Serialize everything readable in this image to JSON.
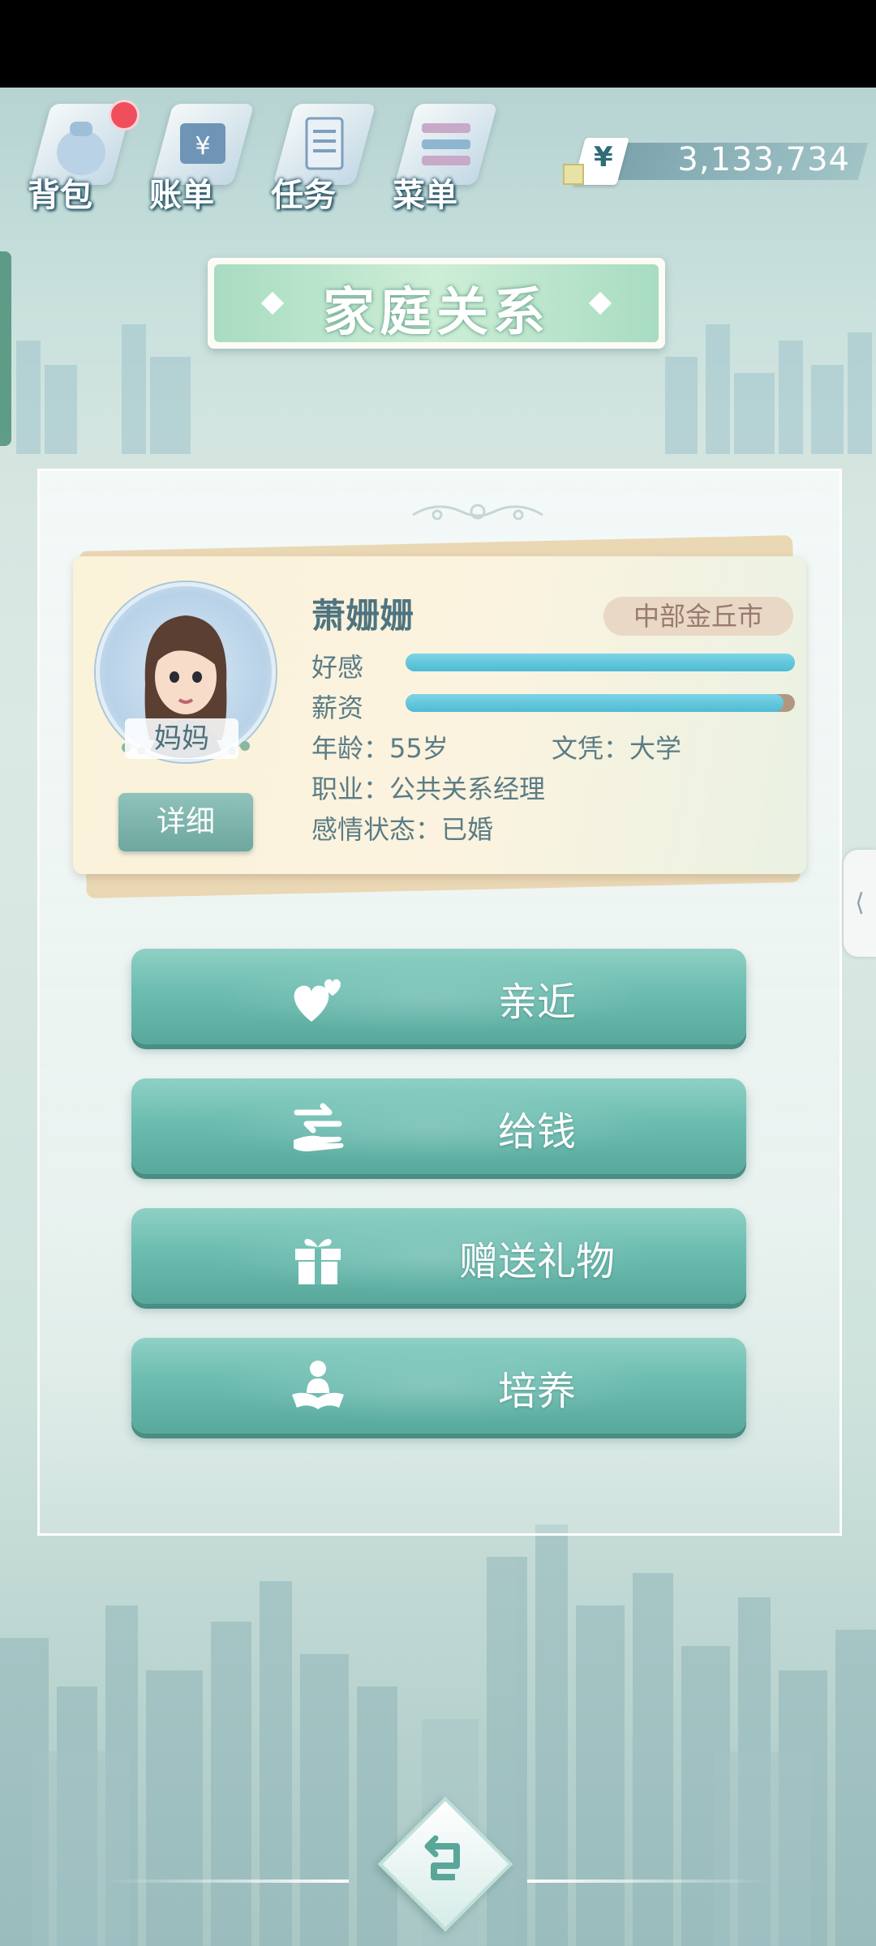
{
  "topbar": {
    "items": [
      {
        "label": "背包",
        "icon": "bag-icon",
        "badge": true
      },
      {
        "label": "账单",
        "icon": "bill-icon"
      },
      {
        "label": "任务",
        "icon": "task-icon"
      },
      {
        "label": "菜单",
        "icon": "menu-icon"
      }
    ],
    "currency_symbol": "¥",
    "money": "3,133,734"
  },
  "page_title": "家庭关系",
  "profile": {
    "name": "萧姗姗",
    "role": "妈妈",
    "region": "中部金丘市",
    "favor_label": "好感",
    "favor_level": 1.0,
    "salary_label": "薪资",
    "salary_level": 0.97,
    "age_text": "年龄：55岁",
    "education_text": "文凭：大学",
    "job_text": "职业：公共关系经理",
    "relationship_text": "感情状态：已婚",
    "detail_button": "详细"
  },
  "actions": [
    {
      "label": "亲近",
      "icon": "hearts-icon"
    },
    {
      "label": "给钱",
      "icon": "give-money-icon"
    },
    {
      "label": "赠送礼物",
      "icon": "gift-icon"
    },
    {
      "label": "培养",
      "icon": "reading-icon"
    }
  ],
  "side_tab": "⟨",
  "colors": {
    "accent": "#6cbcb0",
    "bar": "#4dbbd3",
    "badge": "#ef4f5c"
  }
}
